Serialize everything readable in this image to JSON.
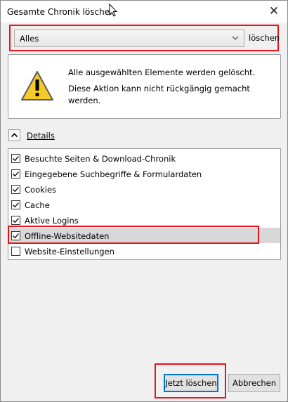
{
  "window": {
    "title": "Gesamte Chronik löschen",
    "close_glyph": "✕"
  },
  "timerange": {
    "selected": "Alles",
    "suffix_label": "löschen"
  },
  "warning": {
    "icon": "warning-triangle-icon",
    "line1": "Alle ausgewählten Elemente werden gelöscht.",
    "line2": "Diese Aktion kann nicht rückgängig gemacht werden."
  },
  "details": {
    "label": "Details",
    "expanded": true
  },
  "items": [
    {
      "label": "Besuchte Seiten & Download-Chronik",
      "checked": true
    },
    {
      "label": "Eingegebene Suchbegriffe & Formulardaten",
      "checked": true
    },
    {
      "label": "Cookies",
      "checked": true
    },
    {
      "label": "Cache",
      "checked": true
    },
    {
      "label": "Aktive Logins",
      "checked": true
    },
    {
      "label": "Offline-Websitedaten",
      "checked": true,
      "selected": true
    },
    {
      "label": "Website-Einstellungen",
      "checked": false
    }
  ],
  "buttons": {
    "clear_now": "Jetzt löschen",
    "cancel": "Abbrechen"
  },
  "colors": {
    "highlight": "#e8141b",
    "focus": "#0078d7",
    "warning_yellow": "#f7c928"
  }
}
